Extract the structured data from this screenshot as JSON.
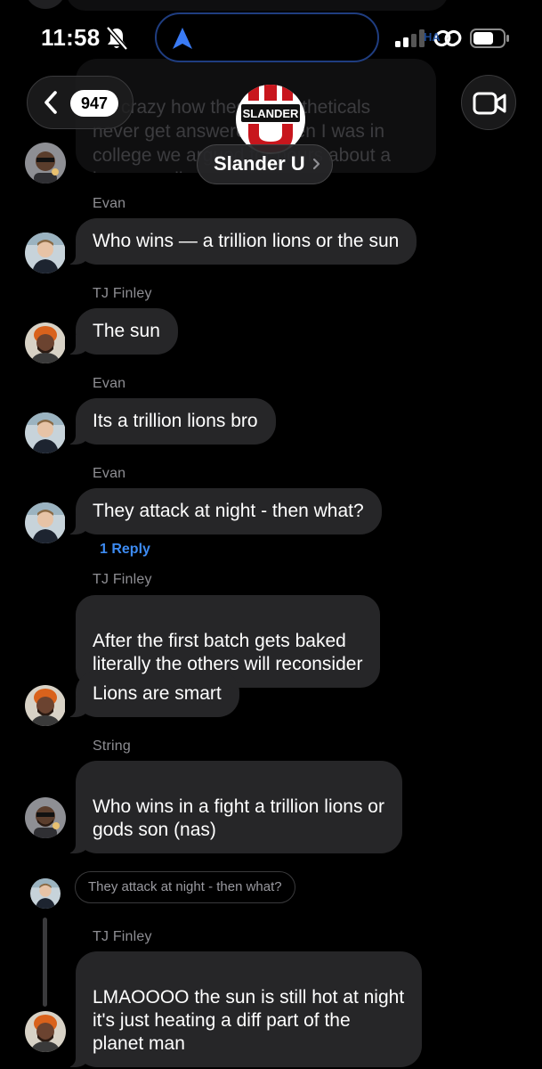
{
  "status_bar": {
    "time": "11:58",
    "watermark": "HA"
  },
  "nav": {
    "back_count": "947",
    "group_name": "Slander U",
    "logo_text": "SLANDER"
  },
  "partial_message": {
    "text": "It's crazy how these hypotheticals never get answered. When I was in college we argued for hours about a bear vs a lion"
  },
  "messages": [
    {
      "sender": "Evan",
      "text": "Who wins — a trillion lions or the sun",
      "avatar": "evan"
    },
    {
      "sender": "TJ Finley",
      "text": "The sun",
      "avatar": "tj"
    },
    {
      "sender": "Evan",
      "text": "Its a trillion lions bro",
      "avatar": "evan"
    },
    {
      "sender": "Evan",
      "text": "They attack at night - then what?",
      "avatar": "evan",
      "reply_link": "1 Reply"
    },
    {
      "sender": "TJ Finley",
      "text": "After the first batch gets baked\nliterally the others will reconsider"
    },
    {
      "text": "Lions are smart",
      "avatar": "tj"
    },
    {
      "sender": "String",
      "text": "Who wins in a fight a trillion lions or\ngods son (nas)",
      "avatar": "string"
    }
  ],
  "thread": {
    "quoted_text": "They attack at night - then what?",
    "reply_sender": "TJ Finley",
    "reply_text": "LMAOOOO the sun is still hot at night\nit's just heating a diff part of the\nplanet man"
  },
  "colors": {
    "background": "#000000",
    "bubble": "#262628",
    "sender_label": "#8e8e93",
    "reply_link": "#3d8bf2",
    "island_border": "#1f3d80",
    "logo_red": "#c8161d"
  },
  "icons": [
    "bell-slash-icon",
    "location-arrow-icon",
    "signal-icon",
    "personal-hotspot-icon",
    "battery-icon",
    "chevron-left-icon",
    "video-camera-icon",
    "chevron-right-icon"
  ]
}
